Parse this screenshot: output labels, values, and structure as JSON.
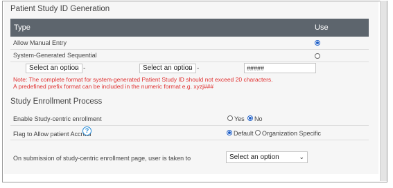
{
  "patient_id_section": {
    "title": "Patient Study ID Generation",
    "columns": {
      "type": "Type",
      "use": "Use"
    },
    "rows": [
      {
        "label": "Allow Manual Entry",
        "selected": true
      },
      {
        "label": "System-Generated Sequential",
        "selected": false
      }
    ],
    "format": {
      "prefix_select_1": "Select an option",
      "separator_1": "-",
      "prefix_select_2": "Select an option",
      "separator_2": "-",
      "numeric_format": "#####"
    },
    "note_line_1": "Note: The complete format for system-generated Patient Study ID should not exceed 20 characters.",
    "note_line_2": "A predefined prefix format can be included in the numeric format e.g. xyzj###"
  },
  "enrollment_section": {
    "title": "Study Enrollment Process",
    "enable_label": "Enable Study-centric enrollment",
    "enable_options": [
      {
        "label": "Yes",
        "selected": false
      },
      {
        "label": "No",
        "selected": true
      }
    ],
    "accrual_label": "Flag to Allow patient Accrual",
    "help_icon": "question-circle-icon",
    "accrual_options": [
      {
        "label": "Default",
        "selected": true
      },
      {
        "label": "Organization Specific",
        "selected": false
      }
    ],
    "submission_label": "On submission of study-centric enrollment page, user is taken to",
    "submission_select": "Select an option"
  },
  "colors": {
    "table_header": "#5d656d",
    "note_text": "#e03030",
    "radio_checked": "#1f5fc7",
    "help_icon": "#1e88d8"
  }
}
